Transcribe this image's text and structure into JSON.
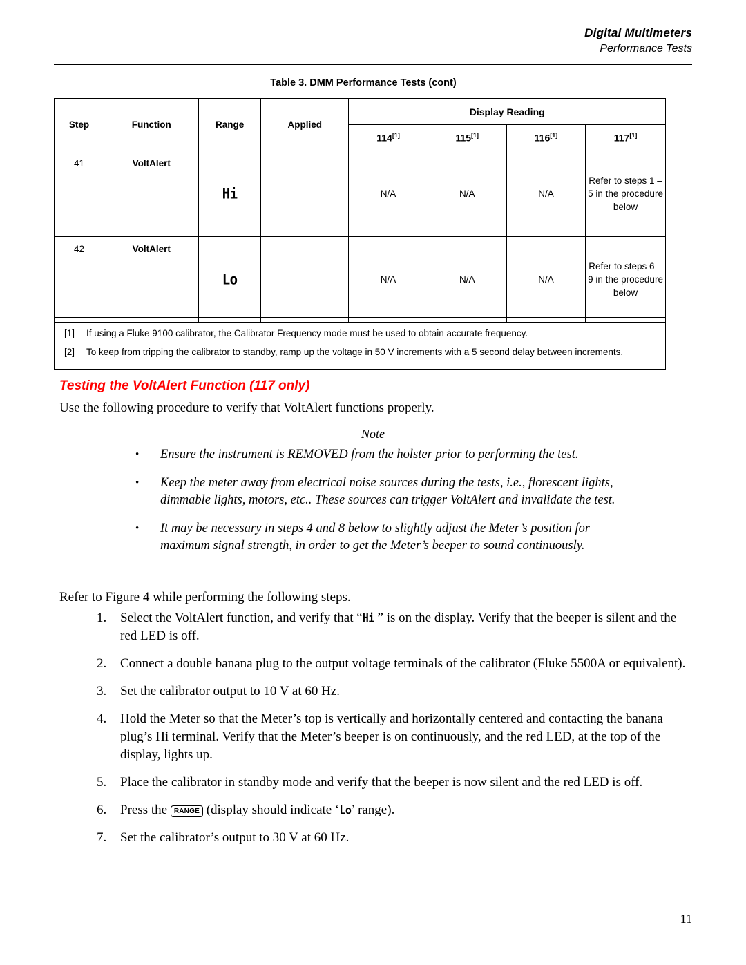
{
  "header": {
    "title": "Digital Multimeters",
    "subtitle": "Performance Tests"
  },
  "table": {
    "caption": "Table 3. DMM Performance Tests (cont)",
    "columns": {
      "step": "Step",
      "function": "Function",
      "range": "Range",
      "applied": "Applied",
      "display_reading": "Display Reading"
    },
    "model_columns": [
      {
        "model": "114",
        "note": "[1]"
      },
      {
        "model": "115",
        "note": "[1]"
      },
      {
        "model": "116",
        "note": "[1]"
      },
      {
        "model": "117",
        "note": "[1]"
      }
    ],
    "rows": [
      {
        "step": "41",
        "function": "VoltAlert",
        "range": "Hi",
        "applied": "",
        "r114": "N/A",
        "r115": "N/A",
        "r116": "N/A",
        "r117": "Refer to steps 1 – 5 in the procedure below"
      },
      {
        "step": "42",
        "function": "VoltAlert",
        "range": "Lo",
        "applied": "",
        "r114": "N/A",
        "r115": "N/A",
        "r116": "N/A",
        "r117": "Refer to steps 6 – 9 in the procedure below"
      }
    ],
    "footnotes": [
      {
        "marker": "[1]",
        "text": "If using a Fluke 9100 calibrator, the Calibrator Frequency mode must be used to obtain accurate frequency."
      },
      {
        "marker": "[2]",
        "text": "To keep from tripping the calibrator to standby, ramp up the voltage in 50 V increments with a 5 second delay between increments."
      }
    ]
  },
  "section": {
    "heading": "Testing the VoltAlert Function (117 only)",
    "heading_color": "#FF0000",
    "intro": "Use the following procedure to verify that VoltAlert functions properly.",
    "note_label": "Note",
    "note_bullets": [
      "Ensure the instrument is REMOVED from the holster prior to performing the test.",
      "Keep the meter away from electrical noise sources during the tests, i.e., florescent lights, dimmable lights, motors, etc..  These sources can trigger VoltAlert and invalidate the test.",
      "It may be necessary in steps 4 and 8 below to slightly adjust the Meter’s position for maximum signal strength, in order to get the Meter’s beeper to sound continuously."
    ],
    "refer_para": "Refer to Figure 4 while performing the following steps.",
    "steps": [
      {
        "num": "1.",
        "text_before": "Select the VoltAlert function, and verify that “",
        "lcd": "Hi",
        "text_after": " ” is on the display.  Verify that the beeper is silent and the red LED is off."
      },
      {
        "num": "2.",
        "text": "Connect a double banana plug to the output voltage terminals of the calibrator (Fluke 5500A or equivalent)."
      },
      {
        "num": "3.",
        "text": "Set the calibrator output to 10 V at 60 Hz."
      },
      {
        "num": "4.",
        "text": "Hold the Meter so that the Meter’s top is vertically and horizontally centered and contacting the banana plug’s Hi terminal.  Verify that the Meter’s beeper is on continuously, and the red LED, at the top of the display, lights up."
      },
      {
        "num": "5.",
        "text": "Place the calibrator in standby mode and verify that the beeper is now silent and the red LED is off."
      },
      {
        "num": "6.",
        "text_before": "Press the ",
        "button": "RANGE",
        "text_mid": " (display should indicate ‘",
        "lcd": "Lo",
        "text_after": "’ range)."
      },
      {
        "num": "7.",
        "text": "Set the calibrator’s output to 30 V at 60 Hz."
      }
    ]
  },
  "page_number": "11"
}
